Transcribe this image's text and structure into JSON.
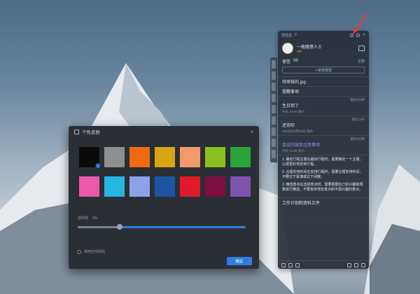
{
  "notes_panel": {
    "topbar": {
      "title": "便签盒",
      "count": "0"
    },
    "user": {
      "name": "一枚随意人士",
      "badge": "VIP"
    },
    "header": {
      "title": "便签",
      "count": "99",
      "sort": "全部"
    },
    "add_label": "+ 新增便签",
    "items": [
      {
        "title": "待审核的.jpg",
        "meta": "",
        "time": ""
      },
      {
        "title": "提醒事项",
        "meta": "",
        "time": ""
      },
      {
        "title": "生日到了",
        "meta": "今天 15:00 周六",
        "time": "最近5分钟"
      },
      {
        "title": "还花呗",
        "meta": "2025年05月30日 周四",
        "time": "最近12天"
      },
      {
        "title": "会议内容及注意事项",
        "meta": "今天 12:05 周六",
        "time": "最近5分钟",
        "accent": true
      }
    ],
    "list_lines": [
      "1. 确定行程主题在最好行程时，需要确定一个主题，以便更好地安排行程。",
      "2. 合理安排时间在安排行程时，需要合理安排时间，不要过于紧凑或过于闲散。",
      "3. 精选景点在选择景点时，需要根据自己的兴趣和预算进行精选，不要盲目地去景点和不感兴趣的景点。"
    ],
    "last_item": "工作计划和资料文件"
  },
  "skin_dialog": {
    "title": "个性皮肤",
    "opacity_label": "透明度",
    "opacity_value": "0%",
    "opacity_fraction": 0.25,
    "follow_label": "使用应用皮肤",
    "ok_label": "确定",
    "swatches": [
      "#0b0b0b",
      "#8e8e8e",
      "#ee6a0c",
      "#d9a512",
      "#f29a6c",
      "#88c21f",
      "#2aa53a",
      "#ec58a8",
      "#24b6e2",
      "#8ba2ea",
      "#1d54a2",
      "#e01a2a",
      "#7d0f42",
      "#7d53ad"
    ],
    "selected_index": 0
  },
  "colors": {
    "accent": "#2f7de1",
    "arrow": "#e33a36"
  }
}
